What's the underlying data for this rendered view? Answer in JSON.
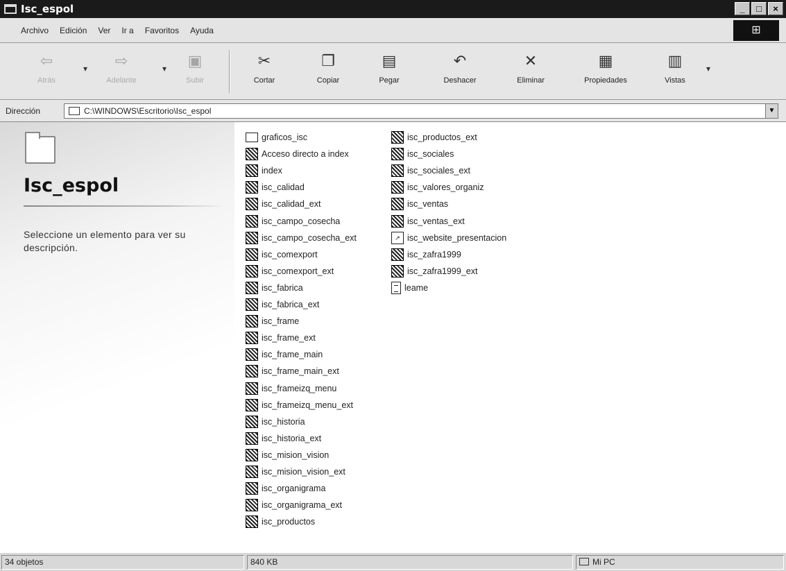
{
  "window": {
    "title": "Isc_espol",
    "buttons": [
      "_",
      "□",
      "×"
    ]
  },
  "menu": [
    "Archivo",
    "Edición",
    "Ver",
    "Ir a",
    "Favoritos",
    "Ayuda"
  ],
  "toolbar": {
    "back": "Atrás",
    "forward": "Adelante",
    "up": "Subir",
    "cut": "Cortar",
    "copy": "Copiar",
    "paste": "Pegar",
    "undo": "Deshacer",
    "delete": "Eliminar",
    "properties": "Propiedades",
    "views": "Vistas"
  },
  "address": {
    "label": "Dirección",
    "path": "C:\\WINDOWS\\Escritorio\\Isc_espol"
  },
  "panel": {
    "title": "Isc_espol",
    "description": "Seleccione un elemento para ver su descripción."
  },
  "files": [
    {
      "name": "graficos_isc",
      "icon": "folder-icon"
    },
    {
      "name": "Acceso directo a index",
      "icon": "web-page-icon"
    },
    {
      "name": "index",
      "icon": "web-page-icon"
    },
    {
      "name": "isc_calidad",
      "icon": "web-page-icon"
    },
    {
      "name": "isc_calidad_ext",
      "icon": "web-page-icon"
    },
    {
      "name": "isc_campo_cosecha",
      "icon": "web-page-icon"
    },
    {
      "name": "isc_campo_cosecha_ext",
      "icon": "web-page-icon"
    },
    {
      "name": "isc_comexport",
      "icon": "web-page-icon"
    },
    {
      "name": "isc_comexport_ext",
      "icon": "web-page-icon"
    },
    {
      "name": "isc_fabrica",
      "icon": "web-page-icon"
    },
    {
      "name": "isc_fabrica_ext",
      "icon": "web-page-icon"
    },
    {
      "name": "isc_frame",
      "icon": "web-page-icon"
    },
    {
      "name": "isc_frame_ext",
      "icon": "web-page-icon"
    },
    {
      "name": "isc_frame_main",
      "icon": "web-page-icon"
    },
    {
      "name": "isc_frame_main_ext",
      "icon": "web-page-icon"
    },
    {
      "name": "isc_frameizq_menu",
      "icon": "web-page-icon"
    },
    {
      "name": "isc_frameizq_menu_ext",
      "icon": "web-page-icon"
    },
    {
      "name": "isc_historia",
      "icon": "web-page-icon"
    },
    {
      "name": "isc_historia_ext",
      "icon": "web-page-icon"
    },
    {
      "name": "isc_mision_vision",
      "icon": "web-page-icon"
    },
    {
      "name": "isc_mision_vision_ext",
      "icon": "web-page-icon"
    },
    {
      "name": "isc_organigrama",
      "icon": "web-page-icon"
    },
    {
      "name": "isc_organigrama_ext",
      "icon": "web-page-icon"
    },
    {
      "name": "isc_productos",
      "icon": "web-page-icon"
    },
    {
      "name": "isc_productos_ext",
      "icon": "web-page-icon"
    },
    {
      "name": "isc_sociales",
      "icon": "web-page-icon"
    },
    {
      "name": "isc_sociales_ext",
      "icon": "web-page-icon"
    },
    {
      "name": "isc_valores_organiz",
      "icon": "web-page-icon"
    },
    {
      "name": "isc_ventas",
      "icon": "web-page-icon"
    },
    {
      "name": "isc_ventas_ext",
      "icon": "web-page-icon"
    },
    {
      "name": "isc_website_presentacion",
      "icon": "shortcut-icon"
    },
    {
      "name": "isc_zafra1999",
      "icon": "web-page-icon"
    },
    {
      "name": "isc_zafra1999_ext",
      "icon": "web-page-icon"
    },
    {
      "name": "leame",
      "icon": "text-document-icon"
    }
  ],
  "status": {
    "objects": "34 objetos",
    "size": "840 KB",
    "zone": "Mi PC"
  }
}
